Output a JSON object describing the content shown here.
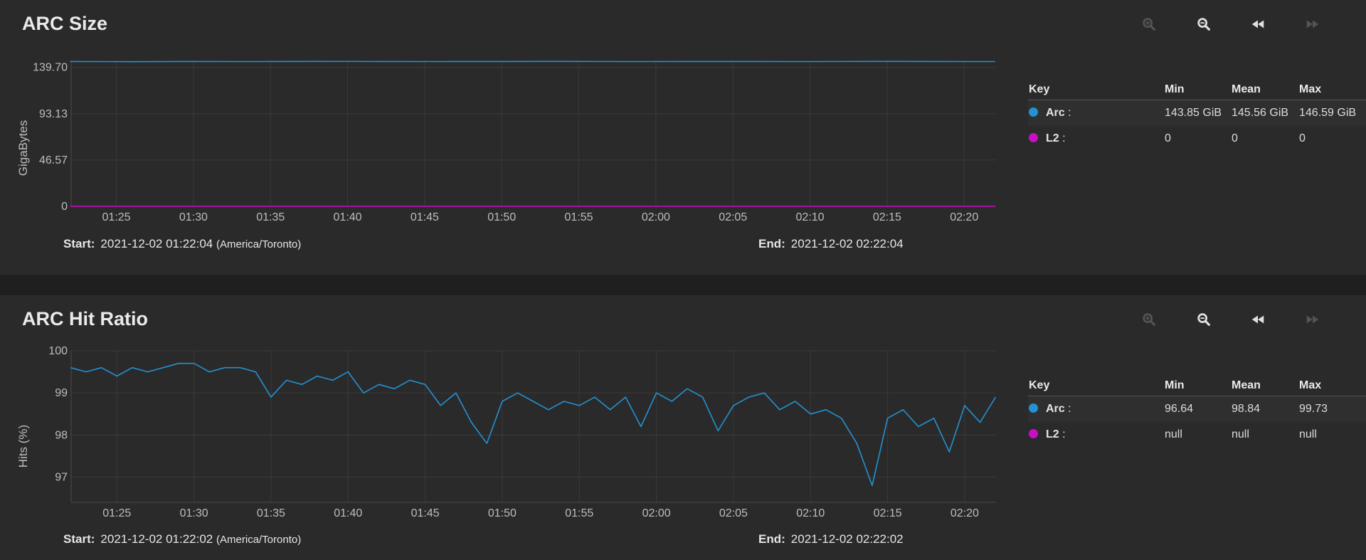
{
  "panels": [
    {
      "title": "ARC Size",
      "range": {
        "start_label": "Start:",
        "start": "2021-12-02 01:22:04",
        "tz": "(America/Toronto)",
        "end_label": "End:",
        "end": "2021-12-02 02:22:04"
      },
      "legend": {
        "headers": {
          "key": "Key",
          "min": "Min",
          "mean": "Mean",
          "max": "Max"
        },
        "rows": [
          {
            "name": "Arc",
            "suffix": ":",
            "color": "#2391d2",
            "min": "143.85 GiB",
            "mean": "145.56 GiB",
            "max": "146.59 GiB"
          },
          {
            "name": "L2",
            "suffix": ":",
            "color": "#c710c4",
            "min": "0",
            "mean": "0",
            "max": "0"
          }
        ]
      }
    },
    {
      "title": "ARC Hit Ratio",
      "range": {
        "start_label": "Start:",
        "start": "2021-12-02 01:22:02",
        "tz": "(America/Toronto)",
        "end_label": "End:",
        "end": "2021-12-02 02:22:02"
      },
      "legend": {
        "headers": {
          "key": "Key",
          "min": "Min",
          "mean": "Mean",
          "max": "Max"
        },
        "rows": [
          {
            "name": "Arc",
            "suffix": ":",
            "color": "#2391d2",
            "min": "96.64",
            "mean": "98.84",
            "max": "99.73"
          },
          {
            "name": "L2",
            "suffix": ":",
            "color": "#c710c4",
            "min": "null",
            "mean": "null",
            "max": "null"
          }
        ]
      }
    }
  ],
  "toolbar_icons": [
    "zoom-in-icon",
    "zoom-out-icon",
    "rewind-icon",
    "fast-forward-icon"
  ],
  "chart_data": [
    {
      "type": "line",
      "title": "ARC Size",
      "ylabel": "GigaBytes",
      "ylim": [
        0,
        146.6
      ],
      "yticks": [
        "0",
        "46.57",
        "93.13",
        "139.70"
      ],
      "xlim": [
        "01:22:04",
        "02:22:04"
      ],
      "xticks": [
        "01:25",
        "01:30",
        "01:35",
        "01:40",
        "01:45",
        "01:50",
        "01:55",
        "02:00",
        "02:05",
        "02:10",
        "02:15",
        "02:20"
      ],
      "grid": true,
      "series": [
        {
          "name": "Arc",
          "color": "#2391d2",
          "x": [
            "01:22",
            "01:26",
            "01:30",
            "01:34",
            "01:38",
            "01:42",
            "01:46",
            "01:50",
            "01:54",
            "01:58",
            "02:02",
            "02:06",
            "02:10",
            "02:14",
            "02:18",
            "02:22"
          ],
          "values": [
            145.6,
            145.4,
            145.6,
            145.5,
            145.7,
            145.6,
            145.5,
            145.6,
            145.7,
            145.5,
            145.6,
            145.6,
            145.5,
            145.7,
            145.6,
            145.5
          ]
        },
        {
          "name": "L2",
          "color": "#c710c4",
          "x": [
            "01:22",
            "02:22"
          ],
          "values": [
            0,
            0
          ]
        }
      ]
    },
    {
      "type": "line",
      "title": "ARC Hit Ratio",
      "ylabel": "Hits (%)",
      "ylim": [
        96.4,
        100
      ],
      "yticks": [
        "97",
        "98",
        "99",
        "100"
      ],
      "xlim": [
        "01:22:02",
        "02:22:02"
      ],
      "xticks": [
        "01:25",
        "01:30",
        "01:35",
        "01:40",
        "01:45",
        "01:50",
        "01:55",
        "02:00",
        "02:05",
        "02:10",
        "02:15",
        "02:20"
      ],
      "grid": true,
      "series": [
        {
          "name": "Arc",
          "color": "#2391d2",
          "x": [
            "01:22",
            "01:23",
            "01:24",
            "01:25",
            "01:26",
            "01:27",
            "01:28",
            "01:29",
            "01:30",
            "01:31",
            "01:32",
            "01:33",
            "01:34",
            "01:35",
            "01:36",
            "01:37",
            "01:38",
            "01:39",
            "01:40",
            "01:41",
            "01:42",
            "01:43",
            "01:44",
            "01:45",
            "01:46",
            "01:47",
            "01:48",
            "01:49",
            "01:50",
            "01:51",
            "01:52",
            "01:53",
            "01:54",
            "01:55",
            "01:56",
            "01:57",
            "01:58",
            "01:59",
            "02:00",
            "02:01",
            "02:02",
            "02:03",
            "02:04",
            "02:05",
            "02:06",
            "02:07",
            "02:08",
            "02:09",
            "02:10",
            "02:11",
            "02:12",
            "02:13",
            "02:14",
            "02:15",
            "02:16",
            "02:17",
            "02:18",
            "02:19",
            "02:20",
            "02:21",
            "02:22"
          ],
          "values": [
            99.6,
            99.5,
            99.6,
            99.4,
            99.6,
            99.5,
            99.6,
            99.7,
            99.7,
            99.5,
            99.6,
            99.6,
            99.5,
            98.9,
            99.3,
            99.2,
            99.4,
            99.3,
            99.5,
            99.0,
            99.2,
            99.1,
            99.3,
            99.2,
            98.7,
            99.0,
            98.3,
            97.8,
            98.8,
            99.0,
            98.8,
            98.6,
            98.8,
            98.7,
            98.9,
            98.6,
            98.9,
            98.2,
            99.0,
            98.8,
            99.1,
            98.9,
            98.1,
            98.7,
            98.9,
            99.0,
            98.6,
            98.8,
            98.5,
            98.6,
            98.4,
            97.8,
            96.8,
            98.4,
            98.6,
            98.2,
            98.4,
            97.6,
            98.7,
            98.3,
            98.9
          ]
        },
        {
          "name": "L2",
          "color": "#c710c4",
          "x": [],
          "values": []
        }
      ]
    }
  ]
}
